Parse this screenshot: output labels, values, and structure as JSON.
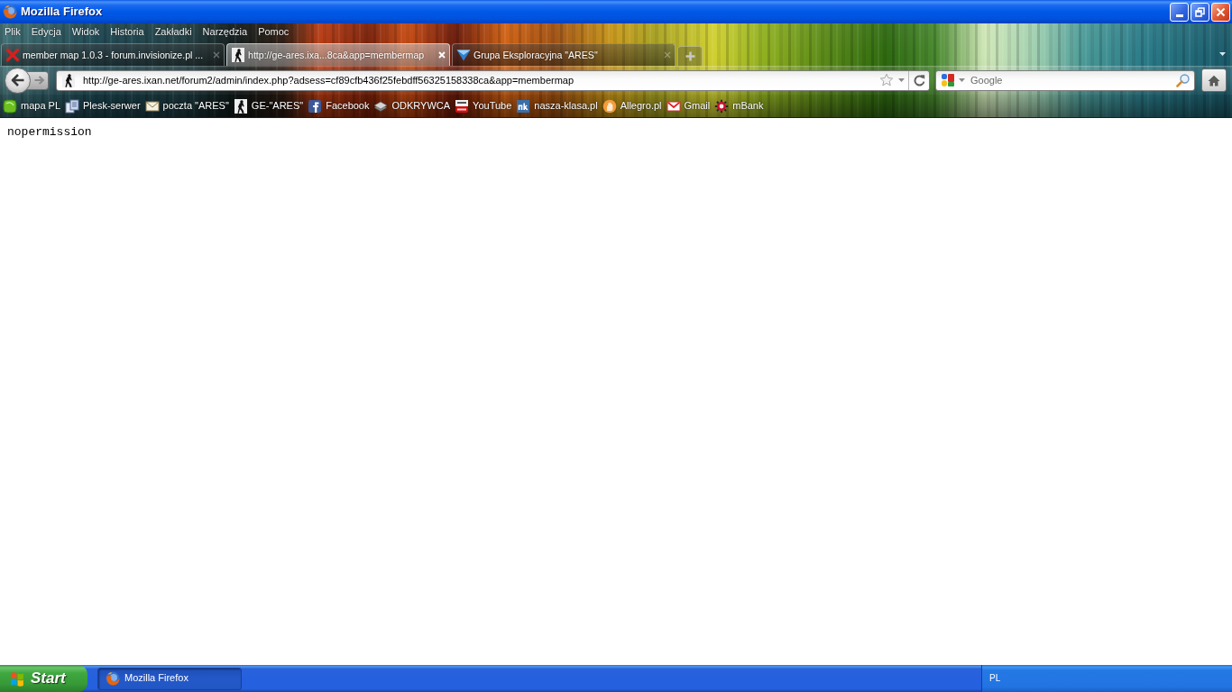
{
  "window": {
    "title": "Mozilla Firefox"
  },
  "menu_bar": [
    "Plik",
    "Edycja",
    "Widok",
    "Historia",
    "Zakładki",
    "Narzędzia",
    "Pomoc"
  ],
  "tabs": [
    {
      "label": "member map 1.0.3 - forum.invisionize.pl ...",
      "selected": false
    },
    {
      "label": "http://ge-ares.ixa...8ca&app=membermap",
      "selected": true
    },
    {
      "label": "Grupa Eksploracyjna \"ARES\"",
      "selected": false
    }
  ],
  "nav_buttons": [
    {
      "kind": "back",
      "disabled": false
    },
    {
      "kind": "forward",
      "disabled": true
    }
  ],
  "address_bar": {
    "value": "http://ge-ares.ixan.net/forum2/admin/index.php?adsess=cf89cfb436f25febdff56325158338ca&app=membermap"
  },
  "search_field": {
    "placeholder": "Google"
  },
  "bookmarks": [
    "mapa PL",
    "Plesk-serwer",
    "poczta \"ARES\"",
    "GE-\"ARES\"",
    "Facebook",
    "ODKRYWCA",
    "YouTube",
    "nasza-klasa.pl",
    "Allegro.pl",
    "Gmail",
    "mBank"
  ],
  "page": {
    "text": "nopermission"
  },
  "taskbar": {
    "start_label": "Start",
    "tasks": [
      {
        "label": "Mozilla Firefox"
      }
    ],
    "tray": {
      "language": "PL"
    }
  }
}
